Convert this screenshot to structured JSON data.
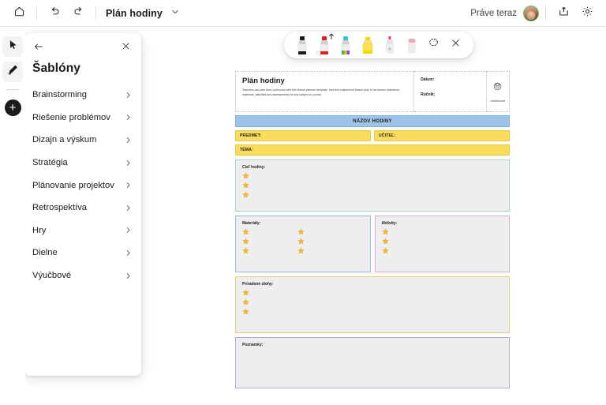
{
  "topbar": {
    "home_icon": "home-icon",
    "undo_icon": "undo-icon",
    "redo_icon": "redo-icon",
    "doc_title": "Plán hodiny",
    "title_chevron_icon": "chevron-down-icon",
    "status": "Práve teraz",
    "avatar": "user-avatar",
    "share_icon": "share-icon",
    "settings_icon": "gear-icon"
  },
  "rail": {
    "select_icon": "cursor-select-icon",
    "pen_icon": "pen-icon",
    "add_label": "+"
  },
  "panel": {
    "back_icon": "back-arrow-icon",
    "close_icon": "close-icon",
    "title": "Šablóny",
    "categories": [
      {
        "label": "Brainstorming"
      },
      {
        "label": "Riešenie problémov"
      },
      {
        "label": "Dizajn a výskum"
      },
      {
        "label": "Stratégia"
      },
      {
        "label": "Plánovanie projektov"
      },
      {
        "label": "Retrospektíva"
      },
      {
        "label": "Hry"
      },
      {
        "label": "Dielne"
      },
      {
        "label": "Výučbové"
      }
    ]
  },
  "pen_toolbar": {
    "pens": [
      {
        "name": "black-marker",
        "color": "#1b1b1b",
        "body": "#efefef",
        "selected": false
      },
      {
        "name": "red-marker",
        "color": "#e02020",
        "body": "#efefef",
        "selected": true
      },
      {
        "name": "rainbow-marker",
        "color": "#39c0c8",
        "body": "#efefef",
        "selected": false
      },
      {
        "name": "yellow-highlighter",
        "color": "#f5d800",
        "body": "#f5e64a",
        "selected": false
      },
      {
        "name": "gray-pen",
        "color": "#e8486b",
        "body": "#e9e9e9",
        "selected": false
      },
      {
        "name": "eraser",
        "color": "#f0a7b5",
        "body": "#ededed",
        "selected": false
      }
    ],
    "lasso_icon": "lasso-select-icon",
    "close_icon": "close-icon"
  },
  "template": {
    "title": "Plán hodiny",
    "description": "Teachers can plan their curriculum with this lesson planner template. Use this customized lesson plan to list lesson objectives, materials, activities and assessments for any subject or course.",
    "field_date": "Dátum:",
    "field_grade": "Ročník:",
    "badge_icon": "education-icon",
    "badge_label": "vzdelávanie",
    "banner": "NÁZOV HODINY",
    "subject": "PREDMET:",
    "teacher": "UČITEĽ:",
    "theme": "TÉMA:",
    "goal": "Cieľ hodiny:",
    "goal_stars": 3,
    "materials": "Materiály:",
    "materials_stars": 6,
    "activities": "Aktivity:",
    "activities_stars": 3,
    "tasks": "Priradené úlohy:",
    "tasks_stars": 3,
    "notes": "Poznámky:",
    "notes_stars": 0,
    "colors": {
      "banner_blue": "#9dc3e6",
      "field_yellow": "#f9dc5c",
      "section_gray": "#eeeeee",
      "goal_border": "#a8d5bb",
      "materials_border": "#8fc0dd",
      "activities_border": "#d8aed0",
      "tasks_border": "#e6cf7a",
      "notes_border": "#b3aed6",
      "star": "#f5b731"
    }
  }
}
